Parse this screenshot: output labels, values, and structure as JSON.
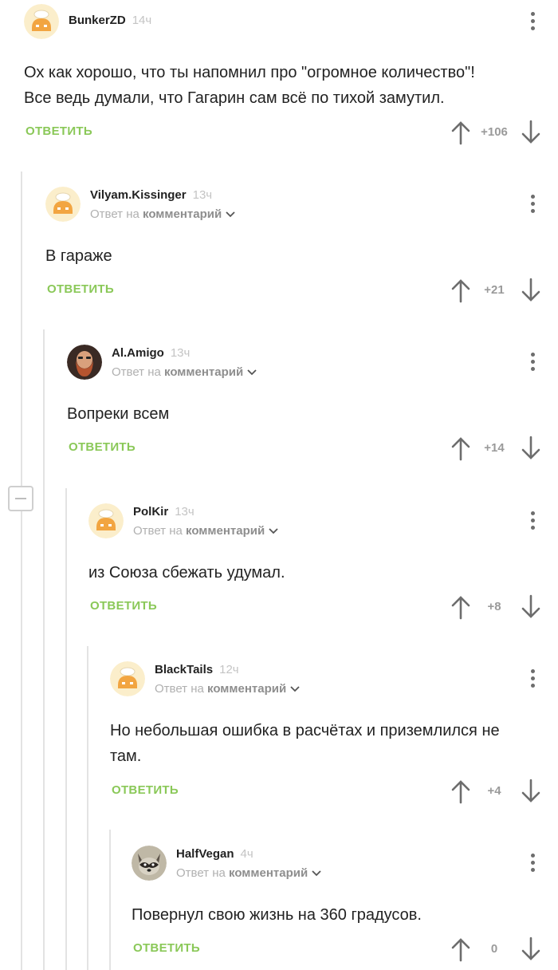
{
  "colors": {
    "accent_green": "#8ac858",
    "username": "#222222",
    "muted": "#b0b0b0",
    "thread_line": "#e3e3e3"
  },
  "reply_prefix": "Ответ на",
  "reply_target": "комментарий",
  "reply_button_label": "ОТВЕТИТЬ",
  "comments": [
    {
      "username": "BunkerZD",
      "time": "14ч",
      "avatar": "default-bun-avatar",
      "text_lines": [
        "Ох как хорошо, что ты напомнил про \"огромное количество\"!",
        "Все ведь думали, что Гагарин сам всё по тихой замутил."
      ],
      "rating": "+106"
    },
    {
      "username": "Vilyam.Kissinger",
      "time": "13ч",
      "avatar": "default-bun-avatar",
      "text_lines": [
        "В гараже"
      ],
      "rating": "+21"
    },
    {
      "username": "Al.Amigo",
      "time": "13ч",
      "avatar": "bearded-man-photo-avatar",
      "text_lines": [
        "Вопреки всем"
      ],
      "rating": "+14"
    },
    {
      "username": "PolKir",
      "time": "13ч",
      "avatar": "default-bun-avatar",
      "text_lines": [
        "из Союза сбежать удумал."
      ],
      "rating": "+8"
    },
    {
      "username": "BlackTails",
      "time": "12ч",
      "avatar": "default-bun-avatar",
      "text_lines": [
        "Но небольшая ошибка в расчётах и приземлился не",
        "там."
      ],
      "rating": "+4"
    },
    {
      "username": "HalfVegan",
      "time": "4ч",
      "avatar": "raccoon-photo-avatar",
      "text_lines": [
        "Повернул свою жизнь на 360 градусов."
      ],
      "rating": "0"
    }
  ]
}
